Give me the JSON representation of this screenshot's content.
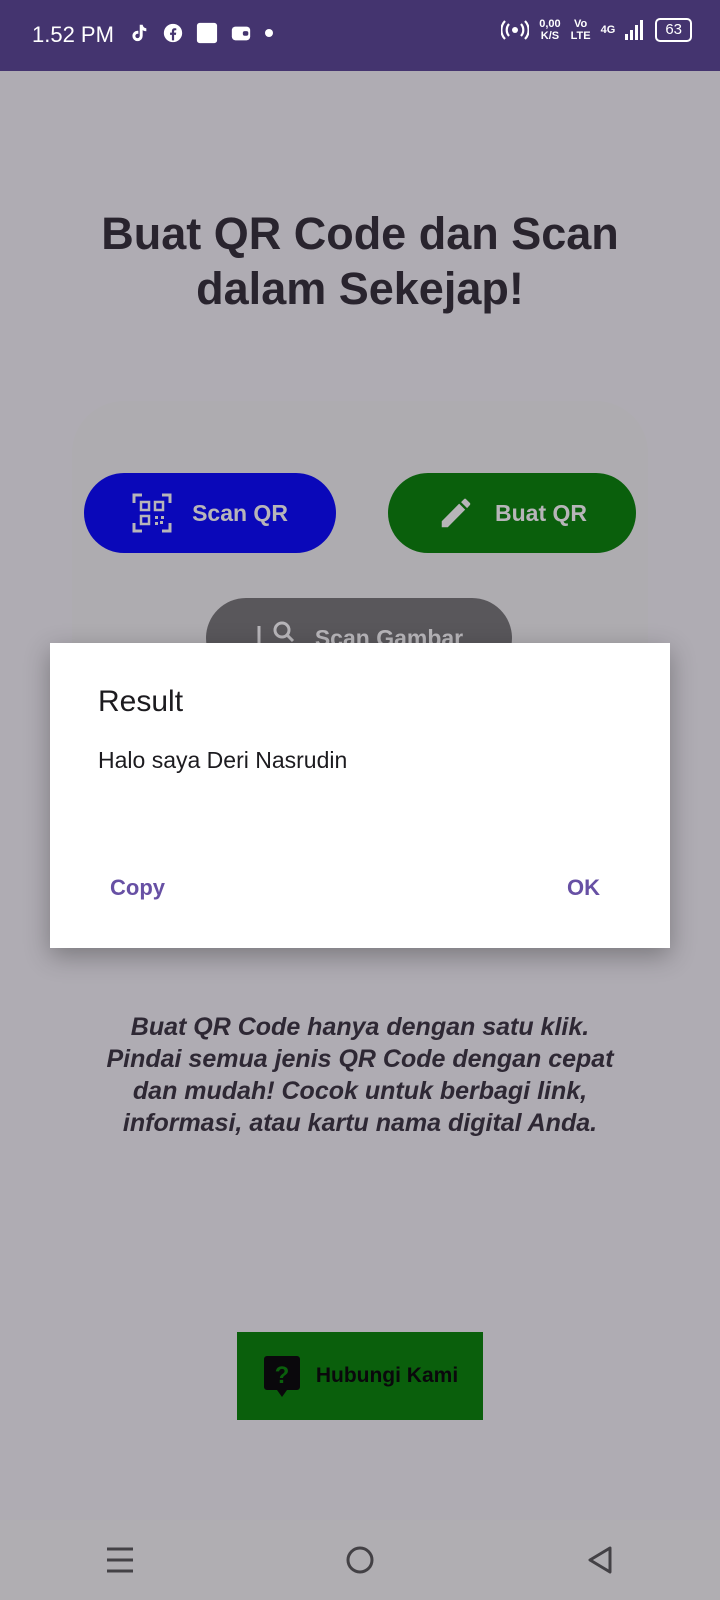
{
  "status_bar": {
    "time": "1.52 PM",
    "net_speed_value": "0,00",
    "net_speed_unit": "K/S",
    "volte_top": "Vo",
    "volte_bottom": "LTE",
    "network": "4G",
    "battery": "63"
  },
  "app": {
    "title": "Buat QR Code dan Scan dalam Sekejap!",
    "buttons": {
      "scan_qr": "Scan QR",
      "buat_qr": "Buat QR",
      "scan_gambar": "Scan Gambar"
    },
    "description": "Buat QR Code hanya dengan satu klik. Pindai semua jenis QR Code dengan cepat dan mudah! Cocok untuk berbagi link, informasi, atau kartu nama digital Anda.",
    "contact_button": "Hubungi Kami",
    "colors": {
      "scan_qr": "#0000ff",
      "buat_qr": "#008000",
      "scan_gambar": "#757575",
      "contact": "#008000",
      "status_bar": "#44346f",
      "dialog_action": "#6750a4"
    }
  },
  "dialog": {
    "title": "Result",
    "message": "Halo saya Deri Nasrudin",
    "copy_label": "Copy",
    "ok_label": "OK"
  },
  "icons": [
    "tiktok-icon",
    "facebook-icon",
    "square-icon",
    "wallet-icon",
    "dot-icon",
    "hotspot-icon",
    "signal-icon",
    "qr-scan-icon",
    "pencil-icon",
    "image-search-icon",
    "help-chat-icon",
    "recents-icon",
    "home-icon",
    "back-icon"
  ]
}
